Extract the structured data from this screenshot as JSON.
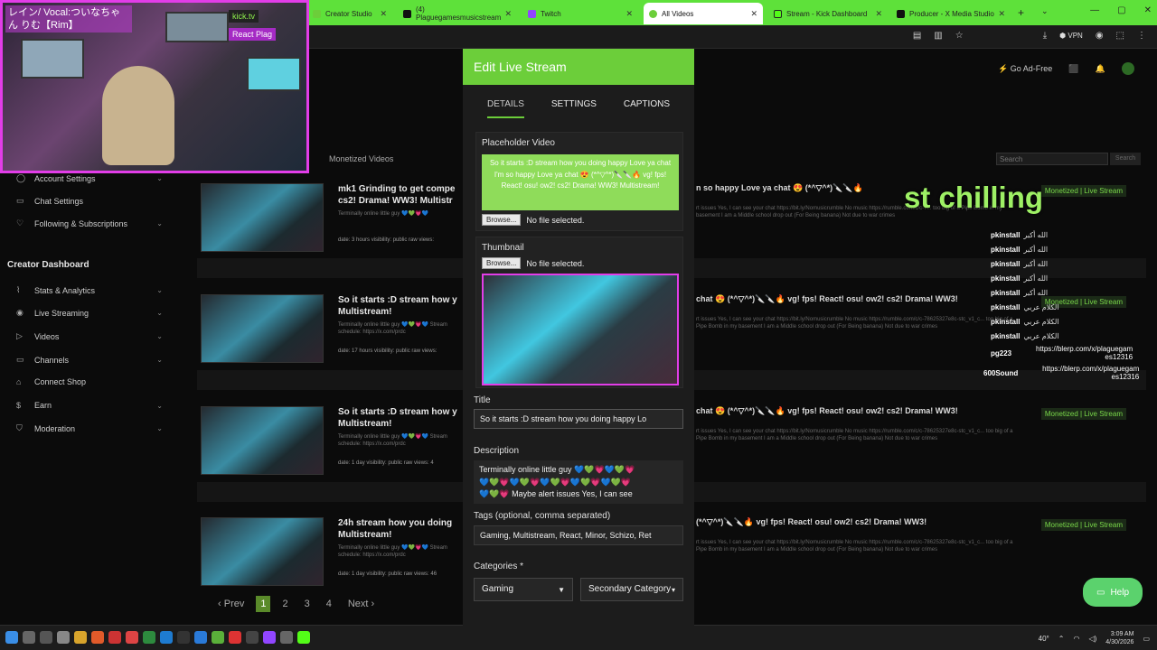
{
  "browser": {
    "tabs": [
      {
        "label": "Creator Studio",
        "color": "#6cce3a"
      },
      {
        "label": "(4) Plaguegamesmusicstream",
        "color": "#111111"
      },
      {
        "label": "Twitch",
        "color": "#9146ff"
      },
      {
        "label": "All Videos",
        "color": "#6cce3a"
      },
      {
        "label": "Stream - Kick Dashboard",
        "color": "#53fc18"
      },
      {
        "label": "Producer - X Media Studio",
        "color": "#111111"
      }
    ],
    "vpn_label": "VPN"
  },
  "webcam": {
    "overlay_text": "レイン/ Vocal:ついなちゃん りむ【Rim】",
    "kick_label": "kick.tv",
    "overlay_label": "React Plag"
  },
  "sidebar": {
    "items": [
      {
        "label": "Account Settings",
        "icon": "user-icon"
      },
      {
        "label": "Chat Settings",
        "icon": "chat-icon"
      },
      {
        "label": "Following & Subscriptions",
        "icon": "heart-icon"
      }
    ],
    "dashboard_heading": "Creator Dashboard",
    "dashboard_items": [
      {
        "label": "Stats & Analytics",
        "icon": "chart-icon"
      },
      {
        "label": "Live Streaming",
        "icon": "broadcast-icon"
      },
      {
        "label": "Videos",
        "icon": "play-icon"
      },
      {
        "label": "Channels",
        "icon": "tv-icon"
      },
      {
        "label": "Connect Shop",
        "icon": "shop-icon"
      },
      {
        "label": "Earn",
        "icon": "dollar-icon"
      },
      {
        "label": "Moderation",
        "icon": "shield-icon"
      }
    ]
  },
  "header": {
    "go_ad_free": "Go Ad-Free",
    "monetized_tab": "Monetized Videos",
    "search_placeholder": "Search",
    "search_button": "Search"
  },
  "videos": [
    {
      "title": "mk1 Grinding to get compe",
      "title2": "cs2! Drama! WW3! Multistr",
      "desc": "Terminally online little guy 💙💚💗💙",
      "meta": "date: 3 hours   visibility: public   raw views:",
      "right_title": "n so happy Love ya chat 😍 (*^▽^*)🔪🔪🔥",
      "right_desc": "rt issues Yes, I can see your chat https://bit.ly/Nomusicrumble No music https://rumble.com/c/c-7... too big of a Pipe Bomb in my basement I am a Middle school drop out (For Being banana) Not due to war crimes",
      "badge": "Monetized | Live Stream"
    },
    {
      "title": "So it starts :D stream how y",
      "title2": "Multistream!",
      "desc": "Terminally online little guy 💙💚💗💙 Stream schedule: https://x.com/prdc",
      "meta": "date: 17 hours   visibility: public   raw views:",
      "right_title": "chat 😍 (*^▽^*)🔪🔪🔥 vg! fps! React! osu! ow2! cs2! Drama! WW3!",
      "right_desc": "rt issues Yes, I can see your chat https://bit.ly/Nomusicrumble No music https://rumble.com/c/c-78625327e8c-stc_v1_c... too big of a Pipe Bomb in my basement I am a Middle school drop out (For Being banana) Not due to war crimes",
      "badge": "Monetized | Live Stream"
    },
    {
      "title": "So it starts :D stream how y",
      "title2": "Multistream!",
      "desc": "Terminally online little guy 💙💚💗💙 Stream schedule: https://x.com/prdc",
      "meta": "date: 1 day   visibility: public   raw views: 4",
      "right_title": "chat 😍 (*^▽^*)🔪🔪🔥 vg! fps! React! osu! ow2! cs2! Drama! WW3!",
      "right_desc": "rt issues Yes, I can see your chat https://bit.ly/Nomusicrumble No music https://rumble.com/c/c-78625327e8c-stc_v1_c... too big of a Pipe Bomb in my basement I am a Middle school drop out (For Being banana) Not due to war crimes",
      "badge": "Monetized | Live Stream"
    },
    {
      "title": "24h stream how you doing",
      "title2": "Multistream!",
      "desc": "Terminally online little guy 💙💚💗💙 Stream schedule: https://x.com/prdc",
      "meta": "date: 1 day   visibility: public   raw views: 46",
      "right_title": "(*^▽^*)🔪🔪🔥 vg! fps! React! osu! ow2! cs2! Drama! WW3!",
      "right_desc": "rt issues Yes, I can see your chat https://bit.ly/Nomusicrumble No music https://rumble.com/c/c-78625327e8c-stc_v1_c... too big of a Pipe Bomb in my basement I am a Middle school drop out (For Being banana) Not due to war crimes",
      "badge": "Monetized | Live Stream"
    }
  ],
  "pager": {
    "prev": "Prev",
    "pages": [
      "1",
      "2",
      "3",
      "4"
    ],
    "next": "Next"
  },
  "overlay": {
    "chilling": "st chilling",
    "chat": [
      {
        "user": "pkinstall",
        "msg": "الله أكبر"
      },
      {
        "user": "pkinstall",
        "msg": "الله أكبر"
      },
      {
        "user": "pkinstall",
        "msg": "الله أكبر"
      },
      {
        "user": "pkinstall",
        "msg": "الله أكبر"
      },
      {
        "user": "pkinstall",
        "msg": "الله أكبر"
      },
      {
        "user": "pkinstall",
        "msg": "الكلام عربي"
      },
      {
        "user": "pkinstall",
        "msg": "الكلام عربي"
      },
      {
        "user": "pkinstall",
        "msg": "الكلام عربي"
      }
    ],
    "link_chat": [
      {
        "user": "pg223",
        "msg": "https://blerp.com/x/plaguegam es12316"
      },
      {
        "user": "600Sound",
        "msg": "https://blerp.com/x/plaguegam es12316"
      }
    ]
  },
  "modal": {
    "title": "Edit Live Stream",
    "tabs": [
      "DETAILS",
      "SETTINGS",
      "CAPTIONS"
    ],
    "placeholder_label": "Placeholder Video",
    "placeholder_text": "So it starts :D stream how you doing happy Love ya chat I'm so happy Love ya chat 😍 (*^▽^*)🔪🔪🔥 vg! fps! React! osu! ow2! cs2! Drama! WW3! Multistream!",
    "browse": "Browse...",
    "no_file": "No file selected.",
    "thumbnail_label": "Thumbnail",
    "title_label": "Title",
    "title_value": "So it starts :D stream how you doing happy Lo",
    "description_label": "Description",
    "description_line1": "Terminally online little guy  💙💚💗💙💚💗",
    "description_line2": "💙💚💗💙💚💗💙💚💗💙💚💗💙💚💗",
    "description_line3": "💙💚💗 Maybe alert issues Yes, I can see",
    "tags_label": "Tags (optional, comma separated)",
    "tags_value": "Gaming, Multistream, React, Minor, Schizo, Ret",
    "categories_label": "Categories *",
    "category_primary": "Gaming",
    "category_secondary": "Secondary Category"
  },
  "help": {
    "label": "Help"
  },
  "taskbar": {
    "time": "3:09 AM",
    "date": "4/30/2026",
    "temp": "40°"
  }
}
